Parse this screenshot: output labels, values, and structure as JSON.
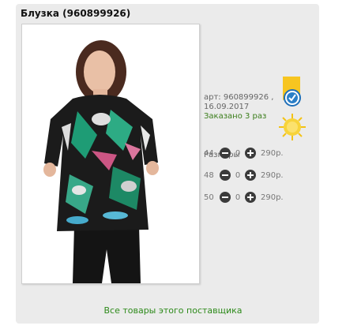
{
  "product": {
    "title": "Блузка (960899926)",
    "article_line": "арт: 960899926 ,",
    "date": "16.09.2017",
    "ordered": "Заказано 3 раз"
  },
  "sizes": {
    "title": "Размеры",
    "rows": [
      {
        "size": "44",
        "qty": "0",
        "price": "290р."
      },
      {
        "size": "48",
        "qty": "0",
        "price": "290р."
      },
      {
        "size": "50",
        "qty": "0",
        "price": "290р."
      }
    ]
  },
  "footer": {
    "supplier_link": "Все товары этого поставщика"
  },
  "colors": {
    "link_green": "#2d8a1a",
    "badge_gold": "#f7c520",
    "check_blue": "#1f6fb8"
  },
  "icons": [
    "bookmark-icon",
    "check-icon",
    "sun-icon",
    "minus-icon",
    "plus-icon"
  ]
}
